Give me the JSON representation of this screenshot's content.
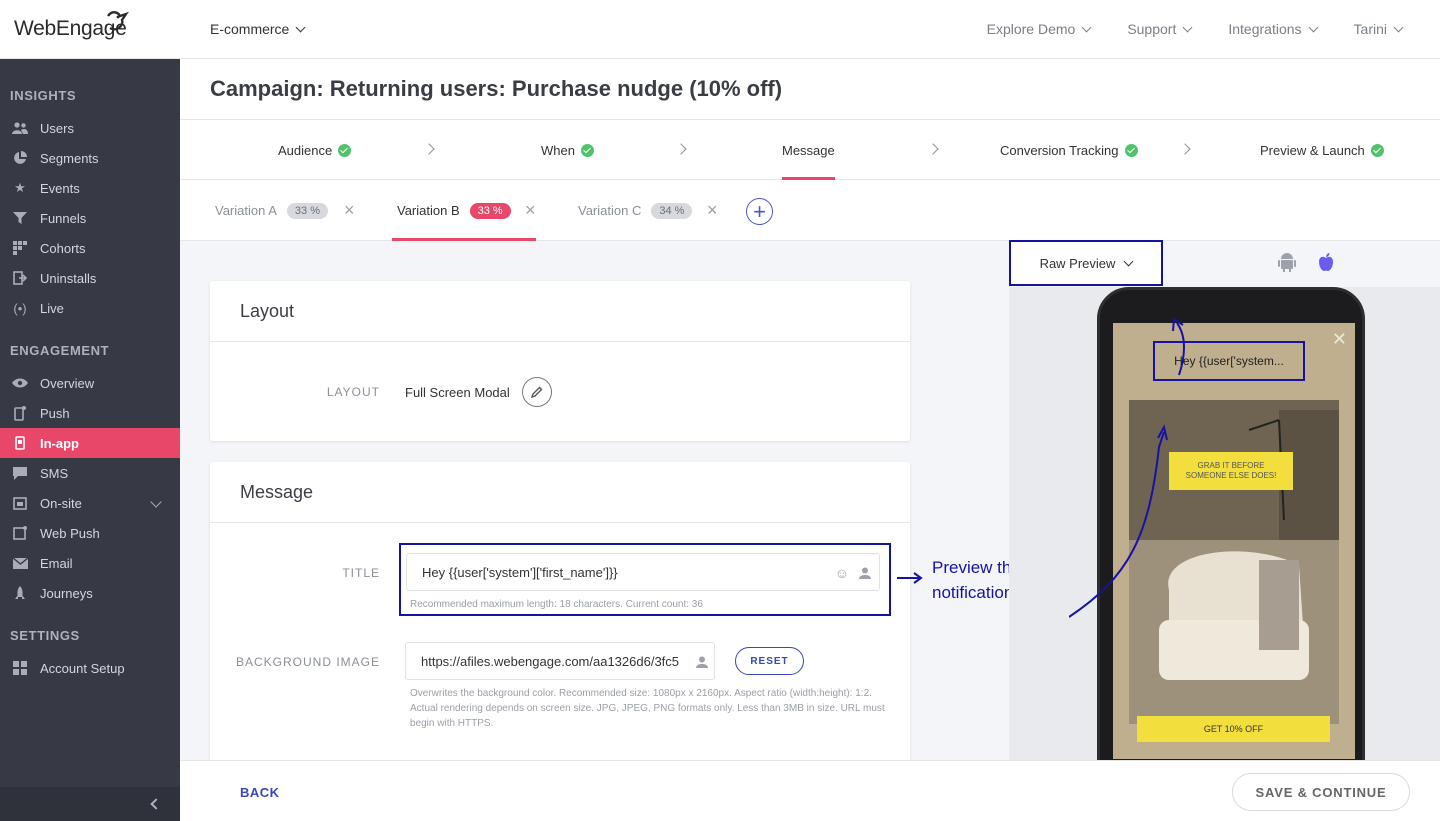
{
  "topbar": {
    "logo": "WebEngage",
    "workspace": "E-commerce",
    "nav": [
      "Explore Demo",
      "Support",
      "Integrations",
      "Tarini"
    ]
  },
  "sidebar": {
    "sections": [
      {
        "title": "INSIGHTS",
        "items": [
          {
            "label": "Users",
            "icon": "users-icon"
          },
          {
            "label": "Segments",
            "icon": "pie-icon"
          },
          {
            "label": "Events",
            "icon": "star-icon"
          },
          {
            "label": "Funnels",
            "icon": "funnel-icon"
          },
          {
            "label": "Cohorts",
            "icon": "grid-icon"
          },
          {
            "label": "Uninstalls",
            "icon": "exit-icon"
          },
          {
            "label": "Live",
            "icon": "broadcast-icon"
          }
        ]
      },
      {
        "title": "ENGAGEMENT",
        "items": [
          {
            "label": "Overview",
            "icon": "eye-icon"
          },
          {
            "label": "Push",
            "icon": "mobile-push-icon"
          },
          {
            "label": "In-app",
            "icon": "in-app-icon"
          },
          {
            "label": "SMS",
            "icon": "chat-icon"
          },
          {
            "label": "On-site",
            "icon": "window-icon"
          },
          {
            "label": "Web Push",
            "icon": "browser-push-icon"
          },
          {
            "label": "Email",
            "icon": "envelope-icon"
          },
          {
            "label": "Journeys",
            "icon": "rocket-icon"
          }
        ]
      },
      {
        "title": "SETTINGS",
        "items": [
          {
            "label": "Account Setup",
            "icon": "grid-settings-icon"
          }
        ]
      }
    ]
  },
  "campaign": {
    "title": "Campaign: Returning users: Purchase nudge (10% off)"
  },
  "steps": [
    "Audience",
    "When",
    "Message",
    "Conversion Tracking",
    "Preview & Launch"
  ],
  "variations": [
    {
      "label": "Variation A",
      "pct": "33 %"
    },
    {
      "label": "Variation B",
      "pct": "33 %"
    },
    {
      "label": "Variation C",
      "pct": "34 %"
    }
  ],
  "layout_card": {
    "title": "Layout",
    "field_label": "LAYOUT",
    "value": "Full Screen Modal"
  },
  "message_card": {
    "title": "Message",
    "title_label": "TITLE",
    "title_value": "Hey {{user['system']['first_name']}}",
    "title_hint": "Recommended maximum length: 18 characters. Current count: 36",
    "bg_label": "BACKGROUND IMAGE",
    "bg_value": "https://afiles.webengage.com/aa1326d6/3fc5",
    "reset": "RESET",
    "bg_hint": "Overwrites the background color. Recommended size: 1080px x 2160px. Aspect ratio (width:height): 1:2. Actual rendering depends on screen size. JPG, JPEG, PNG formats only. Less than 3MB in size. URL must begin with HTTPS."
  },
  "annotation": {
    "line1": "Preview the",
    "line2": "notification as it is"
  },
  "preview": {
    "mode": "Raw Preview",
    "notification_title": "Hey {{user['system...",
    "banner": "GRAB IT BEFORE SOMEONE ELSE DOES!",
    "cta": "GET 10% OFF"
  },
  "footer": {
    "back": "BACK",
    "save": "SAVE & CONTINUE"
  },
  "colors": {
    "accent": "#e8476a",
    "primary": "#3a47b5",
    "annotation": "#1613a3",
    "success": "#52c26a",
    "sidebar": "#373a44"
  }
}
